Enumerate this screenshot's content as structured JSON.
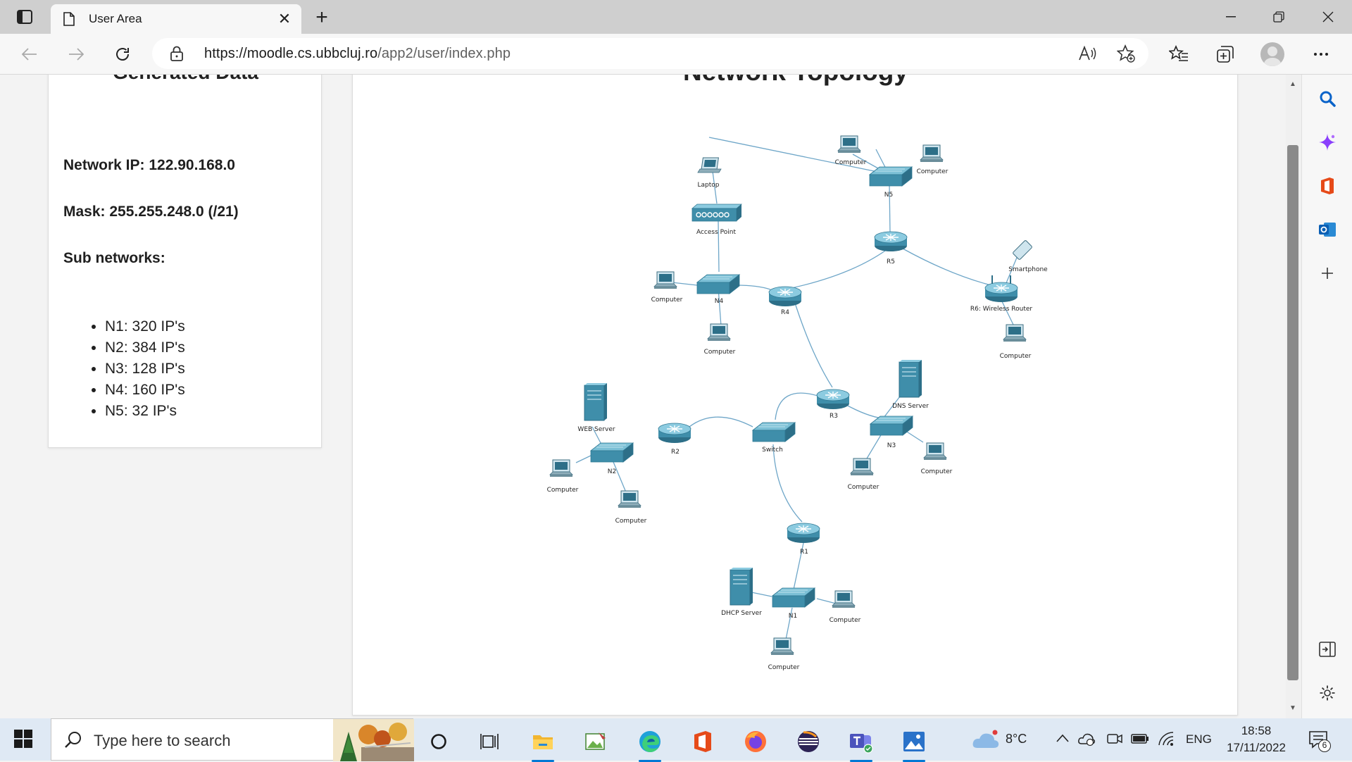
{
  "browser": {
    "tab_title": "User Area",
    "url_host": "https://moodle.cs.ubbcluj.ro",
    "url_path": "/app2/user/index.php"
  },
  "left_card": {
    "heading": "Generated Data",
    "network_ip": "Network IP: 122.90.168.0",
    "mask": "Mask: 255.255.248.0 (/21)",
    "sub_heading": "Sub networks:",
    "subnets": [
      "N1: 320 IP's",
      "N2: 384 IP's",
      "N3: 128 IP's",
      "N4: 160 IP's",
      "N5: 32 IP's"
    ]
  },
  "main_card": {
    "heading": "Network Topology"
  },
  "topology": {
    "labels": {
      "laptop": "Laptop",
      "access_point": "Access Point",
      "n5": "N5",
      "n5_pc1": "Computer",
      "n5_pc2": "Computer",
      "r5": "R5",
      "smartphone": "Smartphone",
      "r6": "R6: Wireless Router",
      "r6_pc": "Computer",
      "n4": "N4",
      "n4_pc1": "Computer",
      "n4_pc2": "Computer",
      "r4": "R4",
      "r3": "R3",
      "dns": "DNS Server",
      "n3": "N3",
      "n3_pc1": "Computer",
      "n3_pc2": "Computer",
      "web": "WEB Server",
      "n2": "N2",
      "n2_pc1": "Computer",
      "n2_pc2": "Computer",
      "r2": "R2",
      "switch": "Switch",
      "r1": "R1",
      "dhcp": "DHCP Server",
      "n1": "N1",
      "n1_pc1": "Computer",
      "n1_pc2": "Computer"
    }
  },
  "taskbar": {
    "search_placeholder": "Type here to search",
    "weather": "8°C",
    "language": "ENG",
    "time": "18:58",
    "date": "17/11/2022",
    "notifications": "6"
  },
  "colors": {
    "device": "#3f8eaa",
    "link": "#6ea6c8",
    "accent": "#0078d4"
  }
}
